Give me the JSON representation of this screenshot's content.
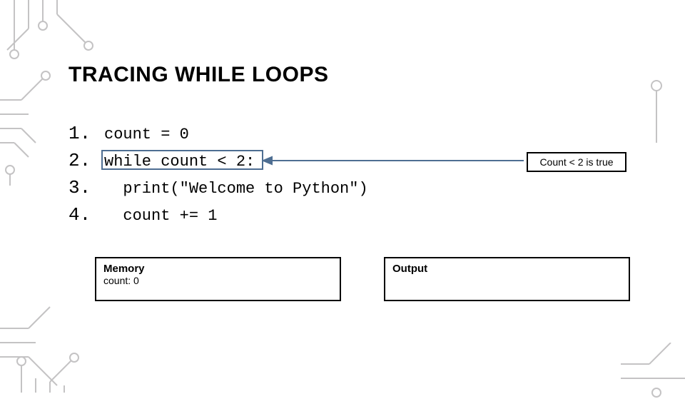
{
  "title": "TRACING WHILE LOOPS",
  "code": {
    "lines": [
      {
        "n": "1.",
        "text": "count = 0"
      },
      {
        "n": "2.",
        "text": "while count < 2:"
      },
      {
        "n": "3.",
        "text": "  print(\"Welcome to Python\")"
      },
      {
        "n": "4.",
        "text": "  count += 1"
      }
    ]
  },
  "annotation": "Count < 2 is true",
  "memory": {
    "title": "Memory",
    "body": "count: 0"
  },
  "output": {
    "title": "Output",
    "body": ""
  }
}
